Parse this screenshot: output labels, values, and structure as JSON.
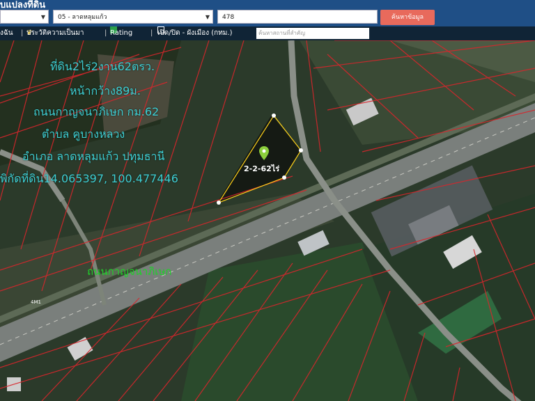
{
  "header": {
    "title_fragment": "บแปลงที่ดิน",
    "province_select": "",
    "district_select": "05 - ลาดหลุมแก้ว",
    "parcel_input": "478",
    "search_button": "ค้นหาข้อมูล"
  },
  "toolbar": {
    "item1": "งฉัน",
    "item2": "ประวัติความเป็นมา",
    "item3": "Rating",
    "item4": "เปิด/ปิด - ผังเมือง (กทม.)",
    "search_placeholder": "ค้นหาสถานที่สำคัญ"
  },
  "map": {
    "overlay_lines": [
      "ที่ดิน2ไร่2งาน62ตรว.",
      "หน้ากว้าง89ม.",
      "ถนนกาญจนาภิเษก กม.62",
      "ตำบล คูบางหลวง",
      "อำเภอ ลาดหลุมแก้ว ปทุมธานี",
      "พิกัดที่ดิน14.065397, 100.477446"
    ],
    "road_label": "ถนนกาญจนาภิเษก",
    "plot_label": "2-2-62ไร่",
    "small_marker": "4M1",
    "colors": {
      "overlay_text": "#3ecfd4",
      "road_label": "#1fd12a",
      "parcel_lines": "#d8262c",
      "plot_outline": "#ffd21a"
    },
    "icons": [
      "map-pin-icon"
    ]
  }
}
